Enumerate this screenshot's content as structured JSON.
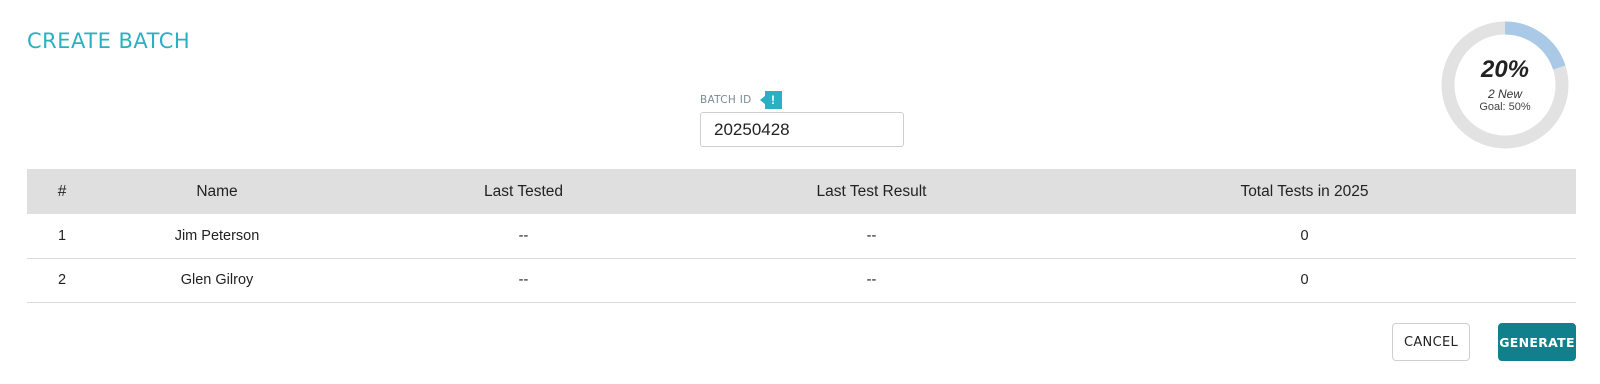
{
  "page": {
    "title": "CREATE BATCH"
  },
  "batch": {
    "label": "BATCH ID",
    "info_flag": "!",
    "value": "20250428"
  },
  "progress": {
    "percent_label": "20%",
    "value": 0.2,
    "new_label": "2 New",
    "goal_label": "Goal: 50%",
    "arc_color": "#a9c9e6",
    "track_color": "#e2e2e2"
  },
  "table": {
    "headers": [
      "#",
      "Name",
      "Last Tested",
      "Last Test Result",
      "Total Tests in 2025"
    ],
    "rows": [
      [
        "1",
        "Jim Peterson",
        "--",
        "--",
        "0"
      ],
      [
        "2",
        "Glen Gilroy",
        "--",
        "--",
        "0"
      ]
    ]
  },
  "actions": {
    "cancel_label": "CANCEL",
    "generate_label": "GENERATE"
  },
  "colors": {
    "accent": "#2bafc2",
    "primary_button": "#127f8c",
    "header_bg": "#e0dfe0"
  }
}
